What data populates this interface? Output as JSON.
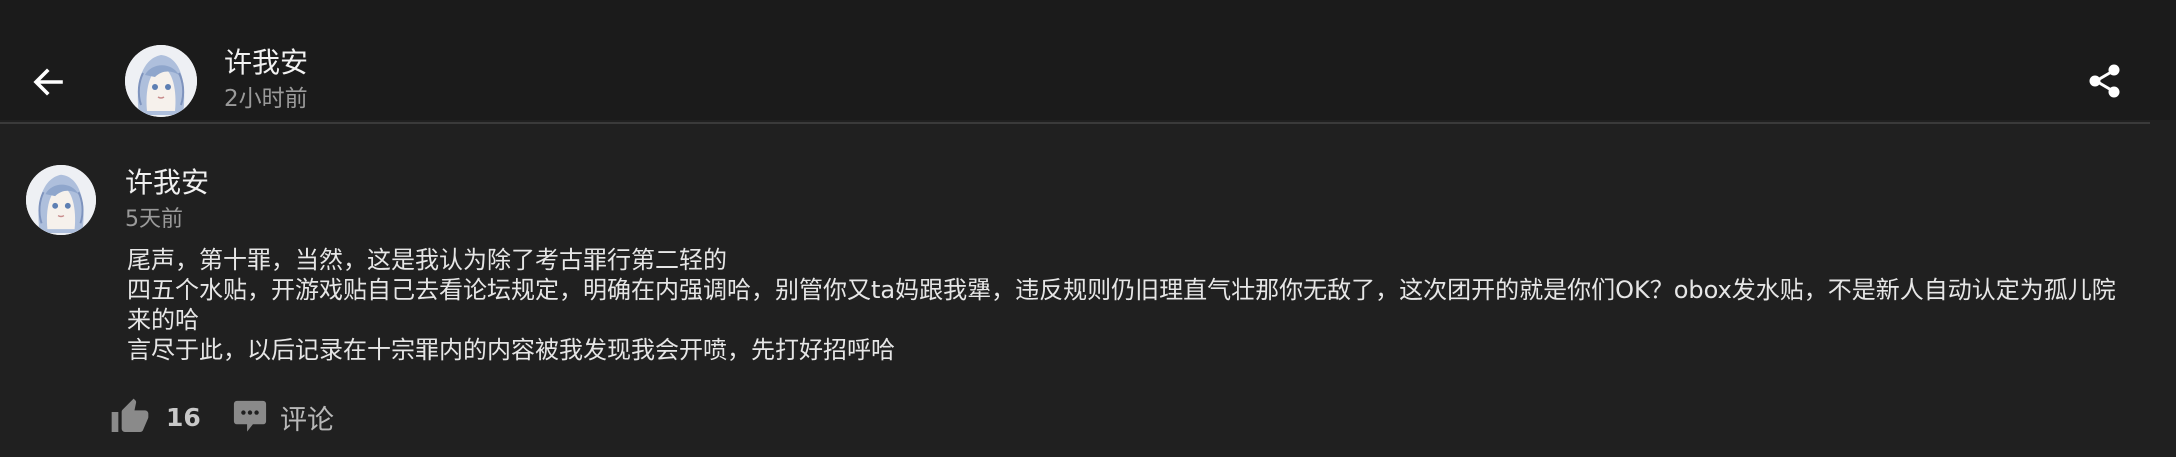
{
  "header": {
    "back_icon": "arrow-left-icon",
    "author_name": "许我安",
    "time": "2小时前",
    "share_icon": "share-icon"
  },
  "post": {
    "author_name": "许我安",
    "time": "5天前",
    "lines": [
      "尾声，第十罪，当然，这是我认为除了考古罪行第二轻的",
      "四五个水贴，开游戏贴自己去看论坛规定，明确在内强调哈，别管你又ta妈跟我犟，违反规则仍旧理直气壮那你无敌了，这次团开的就是你们OK？obox发水贴，不是新人自动认定为孤儿院来的哈",
      "言尽于此，以后记录在十宗罪内的内容被我发现我会开喷，先打好招呼哈"
    ]
  },
  "actions": {
    "like_icon": "thumbs-up-icon",
    "like_count": "16",
    "comment_icon": "comment-icon",
    "comment_label": "评论"
  },
  "colors": {
    "background": "#202020",
    "header_background": "#1b1b1b",
    "text_primary": "#f0f0f0",
    "text_secondary": "#9a9a9a"
  }
}
